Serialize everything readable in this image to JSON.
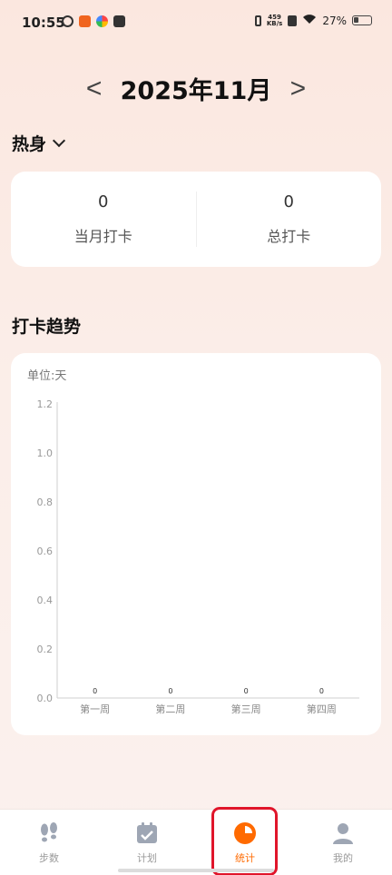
{
  "status_bar": {
    "time": "10:55",
    "net_speed_value": "459",
    "net_speed_unit": "KB/s",
    "battery": "27%"
  },
  "header": {
    "prev_label": "<",
    "next_label": ">",
    "month": "2025年11月"
  },
  "category": {
    "label": "热身"
  },
  "summary": {
    "month_value": "0",
    "month_label": "当月打卡",
    "total_value": "0",
    "total_label": "总打卡"
  },
  "trend": {
    "title": "打卡趋势",
    "unit": "单位:天"
  },
  "chart_data": {
    "type": "bar",
    "categories": [
      "第一周",
      "第二周",
      "第三周",
      "第四周"
    ],
    "values": [
      0,
      0,
      0,
      0
    ],
    "data_labels": [
      "0",
      "0",
      "0",
      "0"
    ],
    "yticks": [
      "0.0",
      "0.2",
      "0.4",
      "0.6",
      "0.8",
      "1.0",
      "1.2"
    ],
    "ylim": [
      0,
      1.2
    ],
    "grid": false
  },
  "tabs": [
    {
      "label": "步数",
      "icon": "footprints-icon",
      "active": false
    },
    {
      "label": "计划",
      "icon": "calendar-check-icon",
      "active": false
    },
    {
      "label": "统计",
      "icon": "pie-chart-icon",
      "active": true
    },
    {
      "label": "我的",
      "icon": "person-icon",
      "active": false
    }
  ],
  "colors": {
    "accent": "#ff6a00",
    "tab_inactive": "#9a9a9a",
    "highlight_box": "#e0152a"
  }
}
